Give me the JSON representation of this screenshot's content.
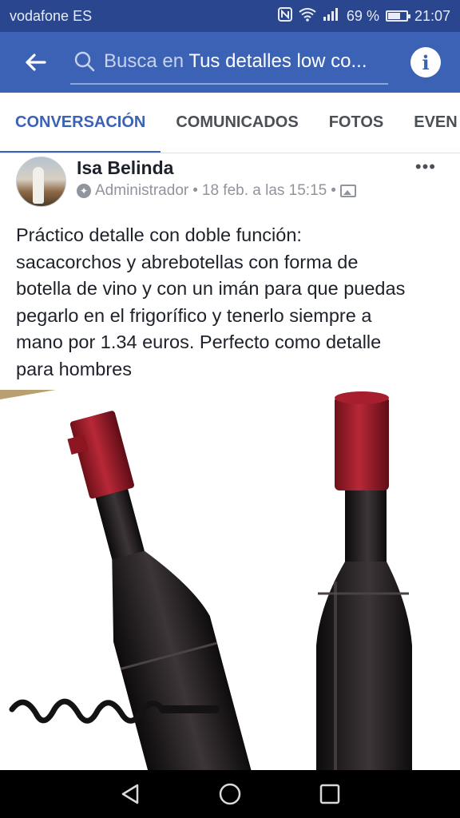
{
  "status_bar": {
    "carrier": "vodafone ES",
    "battery_percent": "69 %",
    "battery_level": 0.69,
    "time": "21:07",
    "icons": [
      "nfc-icon",
      "wifi-icon",
      "signal-icon",
      "battery-icon"
    ]
  },
  "app_bar": {
    "search_prefix": "Busca en",
    "search_group": "Tus detalles low co...",
    "icons": [
      "back-arrow-icon",
      "search-icon",
      "info-icon"
    ],
    "info_glyph": "i"
  },
  "tabs": [
    "CONVERSACIÓN",
    "COMUNICADOS",
    "FOTOS",
    "EVEN"
  ],
  "active_tab": 0,
  "post": {
    "author": "Isa Belinda",
    "role": "Administrador",
    "separator": "•",
    "date": "18 feb. a las 15:15",
    "more": "•••",
    "text_lines": [
      "Práctico detalle con doble función:",
      "sacacorchos y abrebotellas con forma de",
      "botella de vino y con un imán para que puedas",
      "pegarlo en el frigorífico y tenerlo siempre a",
      "mano por 1.34 euros. Perfecto como detalle",
      "para hombres"
    ],
    "image": "wine-bottle-corkscrew-photo"
  },
  "nav_bar": {
    "icons": [
      "back-triangle-icon",
      "home-circle-icon",
      "recents-square-icon"
    ]
  },
  "colors": {
    "status_bar": "#2a468f",
    "app_bar": "#3b62b4",
    "accent": "#3b62b4",
    "bottle": "#1f1b1c",
    "cap": "#9e1c2a"
  }
}
